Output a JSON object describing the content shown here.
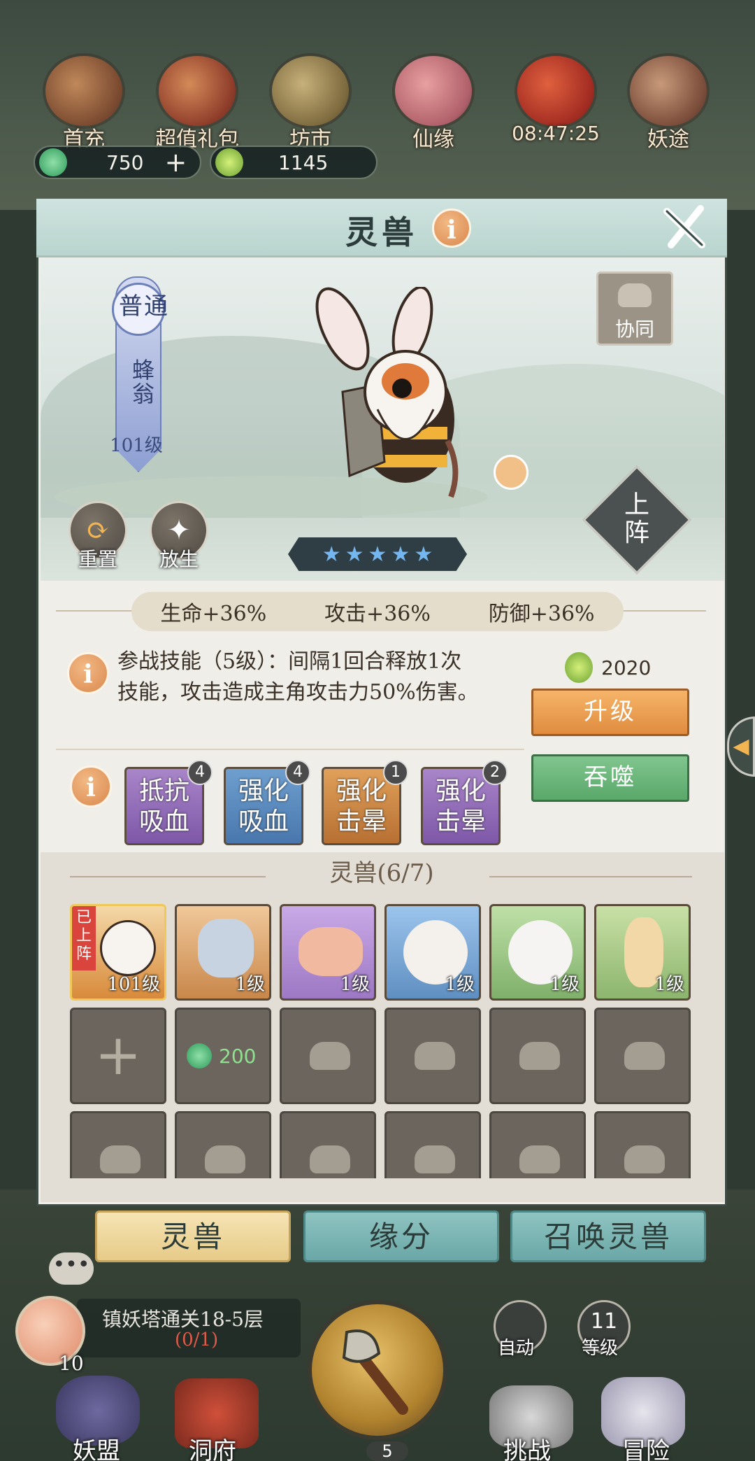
{
  "top_menu": [
    {
      "label": "首充",
      "icon": "pouch-icon"
    },
    {
      "label": "超值礼包",
      "icon": "gift-bag-icon"
    },
    {
      "label": "坊市",
      "icon": "coin-icon"
    },
    {
      "label": "仙缘",
      "icon": "lotus-icon"
    },
    {
      "label": "08:47:25",
      "icon": "gift-box-icon"
    },
    {
      "label": "妖途",
      "icon": "book-icon"
    }
  ],
  "currencies": {
    "spirit_stone": "750",
    "spirit_fruit": "1145"
  },
  "panel": {
    "title": "灵兽",
    "close_icon": "close-icon",
    "info_icon": "i"
  },
  "beast": {
    "rarity": "普通",
    "name": "蜂翁",
    "level": "101级",
    "stars": 5,
    "coop_label": "协同",
    "deploy_label": "上阵",
    "reset_label": "重置",
    "release_label": "放生"
  },
  "stats": {
    "hp": "生命+36%",
    "attack": "攻击+36%",
    "defense": "防御+36%"
  },
  "skill": {
    "description_line1": "参战技能（5级）：间隔1回合释放1次",
    "description_line2": "技能，攻击造成主角攻击力50%伤害。",
    "cost": "2020",
    "upgrade_label": "升级",
    "devour_label": "吞噬"
  },
  "traits": [
    {
      "line1": "抵抗",
      "line2": "吸血",
      "count": "4",
      "color": "purple"
    },
    {
      "line1": "强化",
      "line2": "吸血",
      "count": "4",
      "color": "blue"
    },
    {
      "line1": "强化",
      "line2": "击晕",
      "count": "1",
      "color": "orange"
    },
    {
      "line1": "强化",
      "line2": "击晕",
      "count": "2",
      "color": "purple"
    }
  ],
  "collection": {
    "title": "灵兽(6/7)",
    "deployed_tag": "已上阵",
    "pets": [
      {
        "level": "101级",
        "color": "#d88a3a"
      },
      {
        "level": "1级",
        "color": "#c9874a"
      },
      {
        "level": "1级",
        "color": "#9d78c4"
      },
      {
        "level": "1级",
        "color": "#5f8fc1"
      },
      {
        "level": "1级",
        "color": "#7fb06a"
      },
      {
        "level": "1级",
        "color": "#8cb56e"
      }
    ],
    "unlock_cost": "200"
  },
  "tabs": {
    "beast": "灵兽",
    "fate": "缘分",
    "summon": "召唤灵兽"
  },
  "bottom": {
    "quest": "镇妖塔通关18-5层",
    "quest_progress": "(0/1)",
    "peach_count": "10",
    "auto_label": "自动",
    "level_value": "11",
    "level_label": "等级",
    "nav": [
      "妖盟",
      "洞府",
      "挑战",
      "冒险"
    ],
    "nav_count": "5"
  }
}
